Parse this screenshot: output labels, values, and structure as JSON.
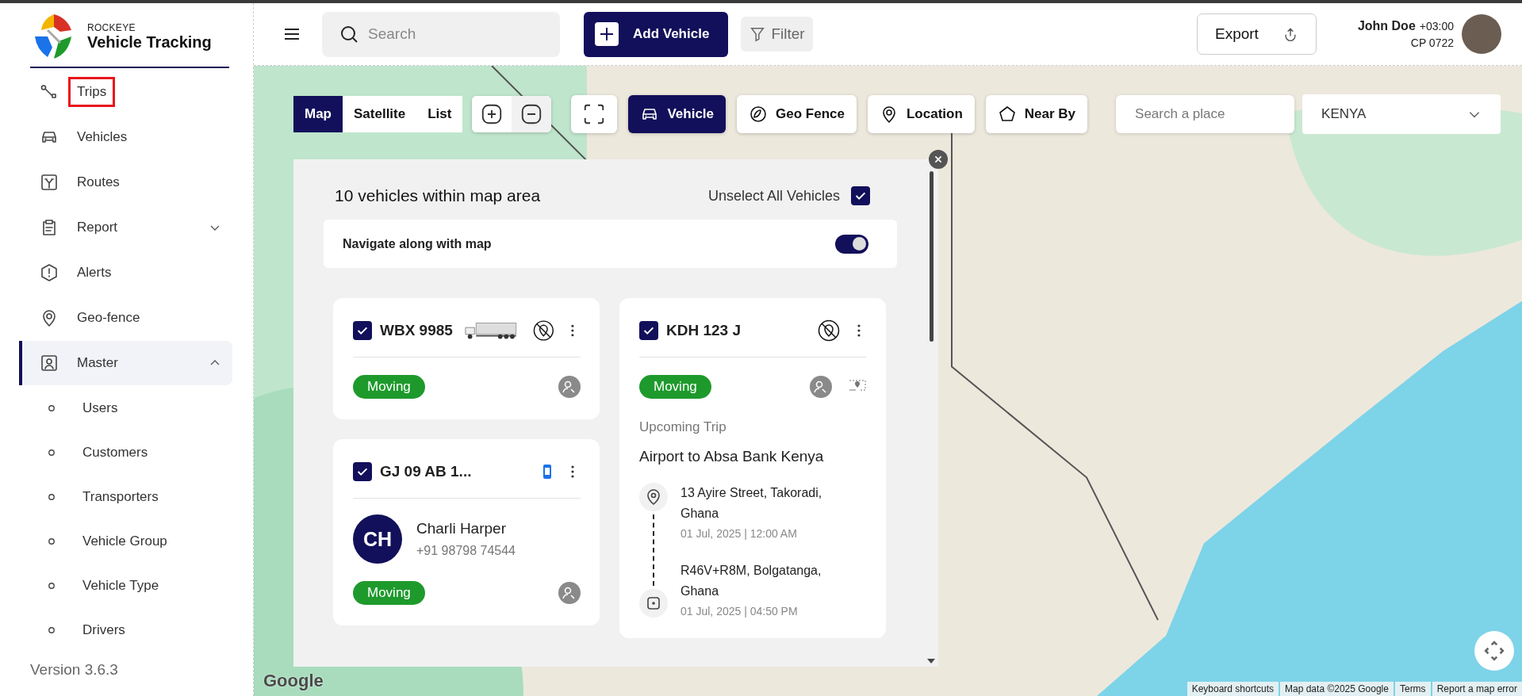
{
  "brand": {
    "company": "ROCKEYE",
    "product": "Vehicle Tracking"
  },
  "sidebar": {
    "items": [
      {
        "label": "Trips",
        "selected": false,
        "highlighted": true
      },
      {
        "label": "Vehicles",
        "selected": false,
        "highlighted": false
      },
      {
        "label": "Routes",
        "selected": false,
        "highlighted": false
      },
      {
        "label": "Report",
        "selected": false,
        "highlighted": false,
        "expanded": false
      },
      {
        "label": "Alerts",
        "selected": false,
        "highlighted": false
      },
      {
        "label": "Geo-fence",
        "selected": false,
        "highlighted": false
      },
      {
        "label": "Master",
        "selected": true,
        "highlighted": false,
        "expanded": true,
        "children": [
          {
            "label": "Users"
          },
          {
            "label": "Customers"
          },
          {
            "label": "Transporters"
          },
          {
            "label": "Vehicle Group"
          },
          {
            "label": "Vehicle Type"
          },
          {
            "label": "Drivers"
          }
        ]
      }
    ],
    "version": "Version 3.6.3"
  },
  "header": {
    "search": {
      "placeholder": "Search"
    },
    "add_button": "Add Vehicle",
    "filter_button": "Filter",
    "export_button": "Export",
    "user": {
      "name": "John Doe",
      "timezone": "+03:00",
      "code": "CP 0722"
    }
  },
  "map_toolbar": {
    "view_tabs": [
      {
        "label": "Map",
        "selected": true
      },
      {
        "label": "Satellite",
        "selected": false
      },
      {
        "label": "List",
        "selected": false
      }
    ],
    "layers": [
      {
        "label": "Vehicle",
        "selected": true
      },
      {
        "label": "Geo Fence",
        "selected": false
      },
      {
        "label": "Location",
        "selected": false
      },
      {
        "label": "Near By",
        "selected": false
      }
    ],
    "place_search": {
      "placeholder": "Search a place"
    },
    "country": "KENYA"
  },
  "panel": {
    "title": "10 vehicles within map area",
    "unselect_label": "Unselect All Vehicles",
    "unselect_checked": true,
    "navigate": {
      "label": "Navigate along with map",
      "on": true
    },
    "columns": [
      [
        {
          "plate": "WBX 9985",
          "kind": "truck",
          "checked": true,
          "gps_off": true,
          "status": "Moving"
        },
        {
          "plate": "GJ 09 AB 1...",
          "kind": "mobile",
          "checked": true,
          "gps_off": false,
          "status": "Moving",
          "driver": {
            "initials": "CH",
            "name": "Charli Harper",
            "phone": "+91 98798 74544"
          }
        }
      ],
      [
        {
          "plate": "KDH 123 J",
          "kind": "plain",
          "checked": true,
          "gps_off": true,
          "status": "Moving",
          "trip": {
            "heading": "Upcoming Trip",
            "name": "Airport to Absa Bank Kenya",
            "stops": [
              {
                "address": "13 Ayire Street, Takoradi, Ghana",
                "time": "01 Jul, 2025 | 12:00 AM"
              },
              {
                "address": "R46V+R8M, Bolgatanga, Ghana",
                "time": "01 Jul, 2025 | 04:50 PM"
              }
            ]
          }
        }
      ]
    ]
  },
  "map_footer": {
    "logo": "Google",
    "attribution": [
      "Keyboard shortcuts",
      "Map data ©2025 Google",
      "Terms",
      "Report a map error"
    ]
  }
}
